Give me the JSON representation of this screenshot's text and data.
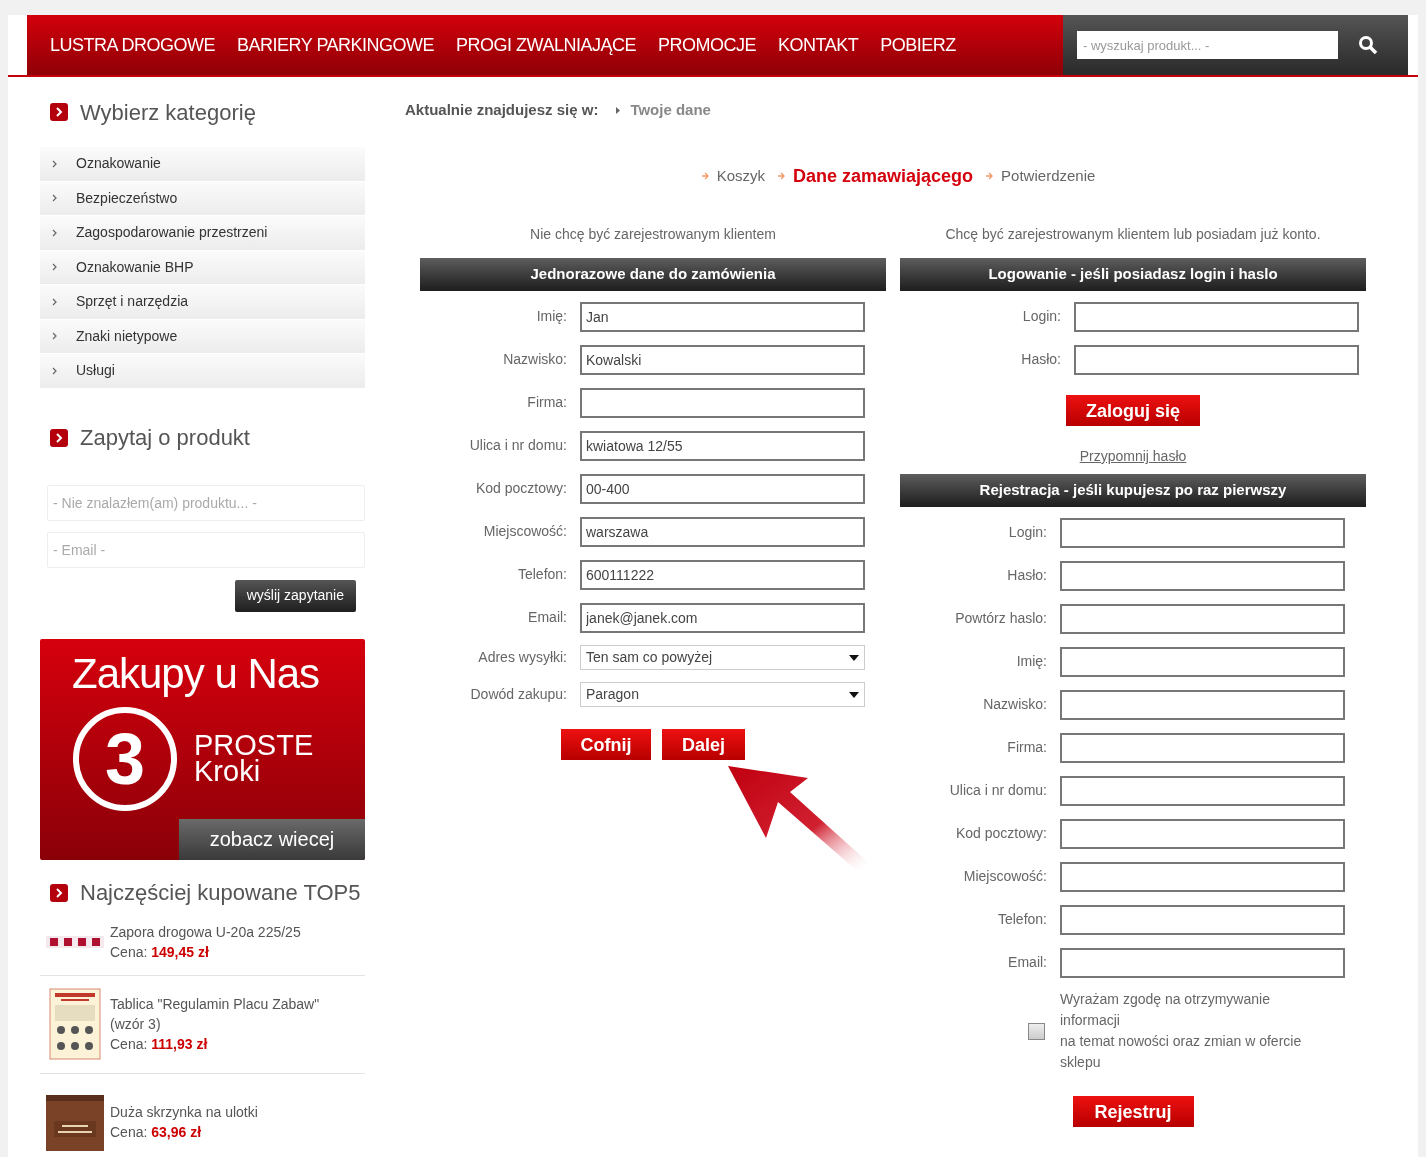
{
  "nav": {
    "items": [
      "LUSTRA DROGOWE",
      "BARIERY PARKINGOWE",
      "PROGI ZWALNIAJĄCE",
      "PROMOCJE",
      "KONTAKT",
      "POBIERZ"
    ],
    "search": {
      "placeholder": "- wyszukaj produkt... -"
    }
  },
  "sidebar": {
    "categories_title": "Wybierz kategorię",
    "categories": [
      "Oznakowanie",
      "Bezpieczeństwo",
      "Zagospodarowanie przestrzeni",
      "Oznakowanie BHP",
      "Sprzęt i narzędzia",
      "Znaki nietypowe",
      "Usługi"
    ],
    "ask": {
      "title": "Zapytaj o produkt",
      "product_placeholder": "- Nie znalazłem(am) produktu... -",
      "email_placeholder": "- Email -",
      "button": "wyślij zapytanie"
    },
    "banner": {
      "title_bold": "Zakupy",
      "title_rest": "u Nas",
      "number": "3",
      "line1": "PROSTE",
      "line2": "Kroki",
      "button": "zobacz wiecej"
    },
    "top_title": "Najczęściej kupowane TOP5",
    "top": [
      {
        "name": "Zapora drogowa U-20a 225/25",
        "price_label": "Cena:",
        "price": "149,45 zł",
        "kind": "barrier"
      },
      {
        "name": "Tablica \"Regulamin Placu Zabaw\" (wzór 3)",
        "price_label": "Cena:",
        "price": "111,93 zł",
        "kind": "sign"
      },
      {
        "name": "Duża skrzynka na ulotki",
        "price_label": "Cena:",
        "price": "63,96 zł",
        "kind": "box"
      }
    ]
  },
  "breadcrumb": {
    "label": "Aktualnie znajdujesz się w:",
    "current": "Twoje dane"
  },
  "steps": [
    {
      "label": "Koszyk",
      "selected": false
    },
    {
      "label": "Dane zamawiającego",
      "selected": true
    },
    {
      "label": "Potwierdzenie",
      "selected": false
    }
  ],
  "guest": {
    "intro": "Nie chcę być zarejestrowanym klientem",
    "header": "Jednorazowe dane do zamówienia",
    "fields": [
      {
        "label": "Imię:",
        "value": "Jan",
        "kind": "text"
      },
      {
        "label": "Nazwisko:",
        "value": "Kowalski",
        "kind": "text"
      },
      {
        "label": "Firma:",
        "kind": "text"
      },
      {
        "label": "Ulica i nr domu:",
        "value": "kwiatowa 12/55",
        "kind": "text"
      },
      {
        "label": "Kod pocztowy:",
        "value": "00-400",
        "kind": "text"
      },
      {
        "label": "Miejscowość:",
        "value": "warszawa",
        "kind": "text"
      },
      {
        "label": "Telefon:",
        "value": "600111222",
        "kind": "text"
      },
      {
        "label": "Email:",
        "value": "janek@janek.com",
        "kind": "text"
      },
      {
        "label": "Adres wysyłki:",
        "value": "Ten sam co powyżej",
        "kind": "select"
      },
      {
        "label": "Dowód zakupu:",
        "value": "Paragon",
        "kind": "select"
      }
    ],
    "buttons": [
      "Cofnij",
      "Dalej"
    ]
  },
  "account": {
    "intro": "Chcę być zarejestrowanym klientem lub posiadam już konto.",
    "login": {
      "header": "Logowanie - jeśli posiadasz login i haslo",
      "fields": [
        {
          "label": "Login:",
          "kind": "text"
        },
        {
          "label": "Hasło:",
          "kind": "text"
        }
      ],
      "button": "Zaloguj się",
      "link": "Przypomnij hasło"
    },
    "register": {
      "header": "Rejestracja - jeśli kupujesz po raz pierwszy",
      "fields": [
        {
          "label": "Login:",
          "kind": "text"
        },
        {
          "label": "Hasło:",
          "kind": "text"
        },
        {
          "label": "Powtórz haslo:",
          "kind": "text"
        },
        {
          "label": "Imię:",
          "kind": "text"
        },
        {
          "label": "Nazwisko:",
          "kind": "text"
        },
        {
          "label": "Firma:",
          "kind": "text"
        },
        {
          "label": "Ulica i nr domu:",
          "kind": "text"
        },
        {
          "label": "Kod pocztowy:",
          "kind": "text"
        },
        {
          "label": "Miejscowość:",
          "kind": "text"
        },
        {
          "label": "Telefon:",
          "kind": "text"
        },
        {
          "label": "Email:",
          "kind": "text"
        }
      ],
      "consent": {
        "lines": [
          "Wyrażam zgodę na otrzymywanie informacji",
          "na temat nowości oraz zmian w ofercie sklepu"
        ],
        "checked": false
      },
      "button": "Rejestruj"
    }
  }
}
